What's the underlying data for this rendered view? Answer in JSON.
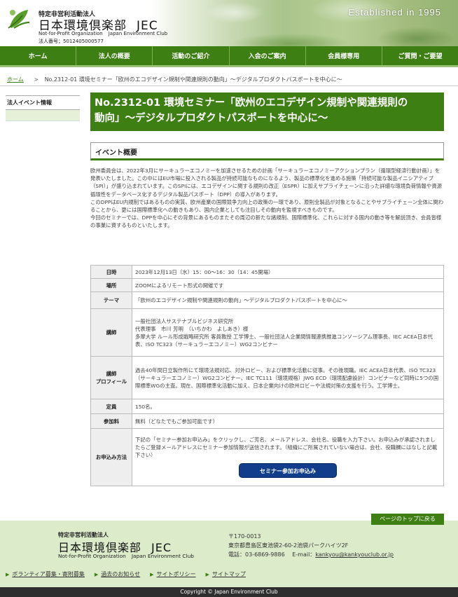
{
  "header": {
    "org_small": "特定非営利活動法人",
    "org_name_jp": "日本環境倶楽部",
    "org_name_abbr": "JEC",
    "org_name_en": "Not-for-Profit Organization",
    "org_name_en2": "Japan Environment Club",
    "corp_number": "法人番号；5012405000577",
    "established": "Established in 1995",
    "logo_icon": "leaf-logo-icon"
  },
  "nav": {
    "items": [
      {
        "label": "ホーム"
      },
      {
        "label": "法人の概要"
      },
      {
        "label": "活動のご紹介"
      },
      {
        "label": "入会のご案内"
      },
      {
        "label": "会員様専用"
      },
      {
        "label": "ご質問・ご要望"
      }
    ]
  },
  "breadcrumb": {
    "home": "ホーム",
    "separator": ">",
    "current": "No.2312-01 環境セミナー「欧州のエコデザイン規制や関連規則の動向」～デジタルプロダクトパスポートを中心に～"
  },
  "sidebar": {
    "heading": "法人イベント情報"
  },
  "main": {
    "title_line1": "No.2312-01 環境セミナー「欧州のエコデザイン規制や関連規則の",
    "title_line2": "動向」～デジタルプロダクトパスポートを中心に～",
    "section_heading": "イベント概要",
    "intro": [
      "欧州委員会は、2022年3月にサーキュラーエコノミーを加速させるための計画「サーキュラーエコノミーアクションプラン（循環型経済行動計画）」を発表いたしました。この中にはEU市場に投入される製品が持続可能なものになるよう、製品の標準化を進める施策「持続可能な製品イニシアティブ（SPI）」が盛り込まれています。このSPIには、エコデザインに関する規則の改正（ESPR）に加えサプライチェーンに沿った詳細な環境負荷情報や資源循環性をデータベース化するデジタル製品パスポート（DPP）の導入があります。",
      "このDPPはEU内規制ではあるものの実質、欧州産業の国際競争力向上の政策の一環であり、原則全製品が対象となることやサプライチェーン全体に関わることから、更には国際標準化への動きもあり、国内企業としても注目しその動向を監視すべきものです。",
      "今回のセミナーでは、DPPを中心にその背景にあるものまたその周辺の新たな諸規制、国際標準化、これらに対する国内の動き等を解説頂き、会員皆様の事業に資するものといたします。"
    ],
    "table": {
      "date_label": "日時",
      "date_value": "2023年12月13日（水）15：00～16：30（14：45開場）",
      "place_label": "場所",
      "place_value": "ZOOMによるリモート形式の開催です",
      "theme_label": "テーマ",
      "theme_value": "「欧州のエコデザイン規制や関連規則の動向」～デジタルプロダクトパスポートを中心に～",
      "speaker_label": "講師",
      "speaker_lines": [
        "一般社団法人サステナブルビジネス研究所",
        "代表理事　市川 芳明　（いちかわ　よしあき）様",
        "多摩大学 ルール形成戦略研究所 客員教授 工学博士、一般社団法人企業間情報連携推進コンソーシアム理事長、IEC ACEA日本代表、ISO TC323（サーキュラーエコノミー）WG2コンビナー"
      ],
      "profile_label_1": "講師",
      "profile_label_2": "プロフィール",
      "profile_value": "過去40年間日立製作所にて環境法規対応、対外ロビー、および標準化活動に従事。その後現職。IEC ACEA日本代表、ISO TC323（サーキュラーエコノミー）WG2コンビナー、IEC TC111（環境規格）JWG ECD（環境配慮設計）コンビナーなど同時に5つの国際標準WGの主査。現在、国際標準化活動に加え、日本企業向けの欧州ロビーや法規対策の支援を行う。工学博士。",
      "capacity_label": "定員",
      "capacity_value": "150名。",
      "fee_label": "参加料",
      "fee_value": "無料（どなたでもご参加可能です）",
      "apply_label": "お申込み方法",
      "apply_value": "下記の「セミナー参加お申込み」をクリックし、ご芳名、メールアドレス、会社名、役職を入力下さい。お申込みが承認されましたらご登録メールアドレスにセミナー参加情報が送信されます。（組織にご所属されていない場合は、会社、役職欄にはなしと記載下さい）",
      "apply_button": "セミナー参加お申込み"
    }
  },
  "pagetop": "ページのトップに戻る",
  "footer": {
    "org_small": "特定非営利活動法人",
    "org_name_jp": "日本環境倶楽部",
    "org_name_abbr": "JEC",
    "org_name_en": "Not-for-Profit Organization",
    "org_name_en2": "Japan Environment Club",
    "postal": "〒170-0013",
    "address": "東京都豊島区東池袋2-60-2池袋パークハイツ2F",
    "tel": "電話：03-6869-9886",
    "email_label": "E-mail：",
    "email": "kankyou@kankyouclub.or.jp",
    "links": [
      {
        "label": "ボランティア募集・寄附募集"
      },
      {
        "label": "過去のお知らせ"
      },
      {
        "label": "サイトポリシー"
      },
      {
        "label": "サイトマップ"
      }
    ],
    "copyright": "Copyright © Japan Environment Club"
  },
  "colors": {
    "brand_green": "#3e7f13",
    "button_blue": "#123d8a",
    "footer_bg": "#dcebca"
  }
}
